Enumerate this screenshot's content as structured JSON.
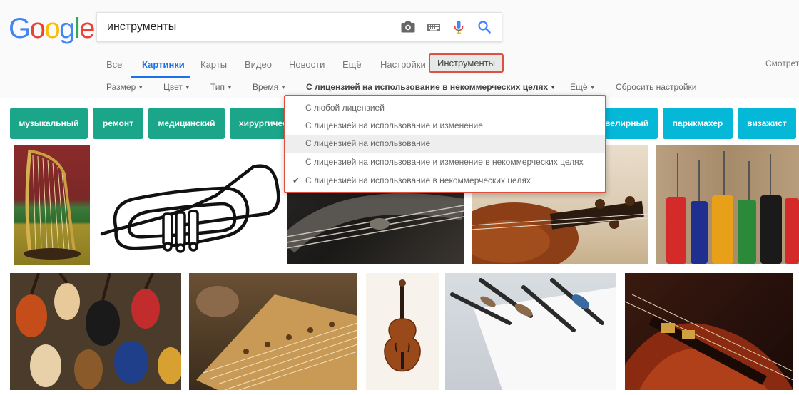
{
  "logo": "Google",
  "search": {
    "query": "инструменты"
  },
  "search_icons": [
    "camera-icon",
    "keyboard-icon",
    "microphone-icon",
    "search-icon"
  ],
  "nav": {
    "tabs": [
      "Все",
      "Картинки",
      "Карты",
      "Видео",
      "Новости",
      "Ещё",
      "Настройки"
    ],
    "active": "Картинки",
    "tools": "Инструменты",
    "view": "Смотрет"
  },
  "filters": {
    "size": "Размер",
    "color": "Цвет",
    "type": "Тип",
    "time": "Время",
    "license": "С лицензией на использование в некоммерческих целях",
    "more": "Ещё",
    "reset": "Сбросить настройки"
  },
  "chips": [
    "музыкальный",
    "ремонт",
    "медицинский",
    "хирургичес",
    "велирный",
    "парикмахер",
    "визажист"
  ],
  "license_menu": {
    "items": [
      "С любой лицензией",
      "С лицензией на использование и изменение",
      "С лицензией на использование",
      "С лицензией на использование и изменение в некоммерческих целях",
      "С лицензией на использование в некоммерческих целях"
    ],
    "highlighted": 2,
    "checked": 4
  },
  "colors": {
    "accent": "#1a73e8",
    "chip_green": "#1ba68a",
    "chip_blue": "#06b8d8",
    "highlight_border": "#e0503e"
  }
}
